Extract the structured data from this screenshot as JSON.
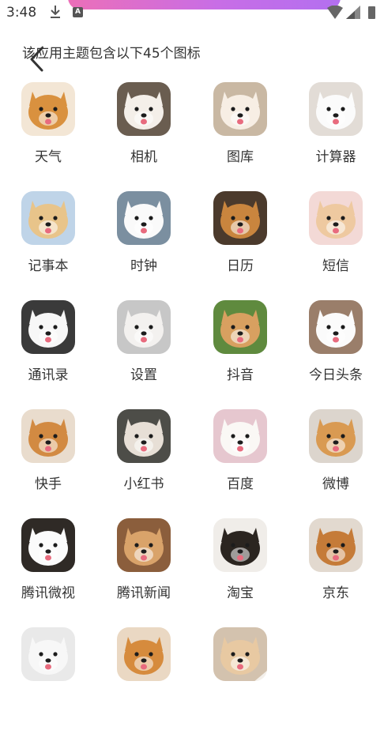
{
  "status_bar": {
    "time": "3:48",
    "download_icon": "download-icon",
    "app_badge": "A",
    "accent_gradient": [
      "#ec6fb8",
      "#b36ff0"
    ]
  },
  "header": {
    "back_icon": "chevron-left-icon",
    "title": "该应用主题包含以下45个图标"
  },
  "icons": [
    {
      "label": "天气",
      "fur": "#d9913f",
      "bg": "#f3e6d5"
    },
    {
      "label": "相机",
      "fur": "#f4efe9",
      "bg": "#6a5d50"
    },
    {
      "label": "图库",
      "fur": "#f7eee4",
      "bg": "#c9b8a3"
    },
    {
      "label": "计算器",
      "fur": "#fbfbfb",
      "bg": "#e2dcd6"
    },
    {
      "label": "记事本",
      "fur": "#e8c48a",
      "bg": "#bfd4e8"
    },
    {
      "label": "时钟",
      "fur": "#fafafa",
      "bg": "#7b8fa0"
    },
    {
      "label": "日历",
      "fur": "#c9853e",
      "bg": "#4b3a2c"
    },
    {
      "label": "短信",
      "fur": "#eec9a0",
      "bg": "#f3d9d6"
    },
    {
      "label": "通讯录",
      "fur": "#f7f7f7",
      "bg": "#3a3a3a"
    },
    {
      "label": "设置",
      "fur": "#f3f1ef",
      "bg": "#c7c7c7"
    },
    {
      "label": "抖音",
      "fur": "#d8a060",
      "bg": "#5f8a3e"
    },
    {
      "label": "今日头条",
      "fur": "#fbfbfb",
      "bg": "#9a7e6a"
    },
    {
      "label": "快手",
      "fur": "#d28a42",
      "bg": "#e9dccd"
    },
    {
      "label": "小红书",
      "fur": "#e7dfd6",
      "bg": "#4d4d48"
    },
    {
      "label": "百度",
      "fur": "#faf8f5",
      "bg": "#e6c7cf"
    },
    {
      "label": "微博",
      "fur": "#d99a52",
      "bg": "#dcd5cd"
    },
    {
      "label": "腾讯微视",
      "fur": "#fbfbfb",
      "bg": "#2f2a26"
    },
    {
      "label": "腾讯新闻",
      "fur": "#d9a36a",
      "bg": "#8b5e3c"
    },
    {
      "label": "淘宝",
      "fur": "#2b2520",
      "bg": "#f0ede9"
    },
    {
      "label": "京东",
      "fur": "#c57b38",
      "bg": "#e2d9cf"
    },
    {
      "label": "",
      "fur": "#f7f7f7",
      "bg": "#e9e9e9"
    },
    {
      "label": "",
      "fur": "#d68b3d",
      "bg": "#ead8c3"
    },
    {
      "label": "",
      "fur": "#e8c9a2",
      "bg": "#d3c2ae"
    }
  ]
}
